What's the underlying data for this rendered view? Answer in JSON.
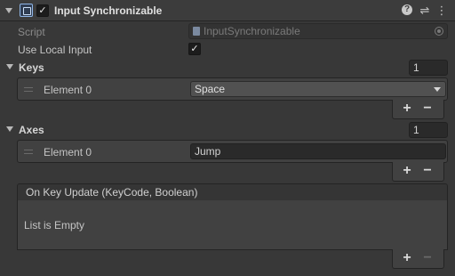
{
  "component": {
    "title": "Input Synchronizable",
    "enabled": true,
    "header_icons": [
      "help-icon",
      "presets-icon",
      "kebab-menu-icon"
    ]
  },
  "script": {
    "label": "Script",
    "value": "InputSynchronizable"
  },
  "use_local_input": {
    "label": "Use Local Input",
    "checked": true
  },
  "keys": {
    "label": "Keys",
    "size": "1",
    "elements": [
      {
        "label": "Element 0",
        "value": "Space"
      }
    ],
    "add": "+",
    "remove": "−"
  },
  "axes": {
    "label": "Axes",
    "size": "1",
    "elements": [
      {
        "label": "Element 0",
        "value": "Jump"
      }
    ],
    "add": "+",
    "remove": "−"
  },
  "event": {
    "header": "On Key Update (KeyCode, Boolean)",
    "empty_text": "List is Empty",
    "add": "+",
    "remove": "−"
  },
  "glyphs": {
    "check": "✓"
  }
}
